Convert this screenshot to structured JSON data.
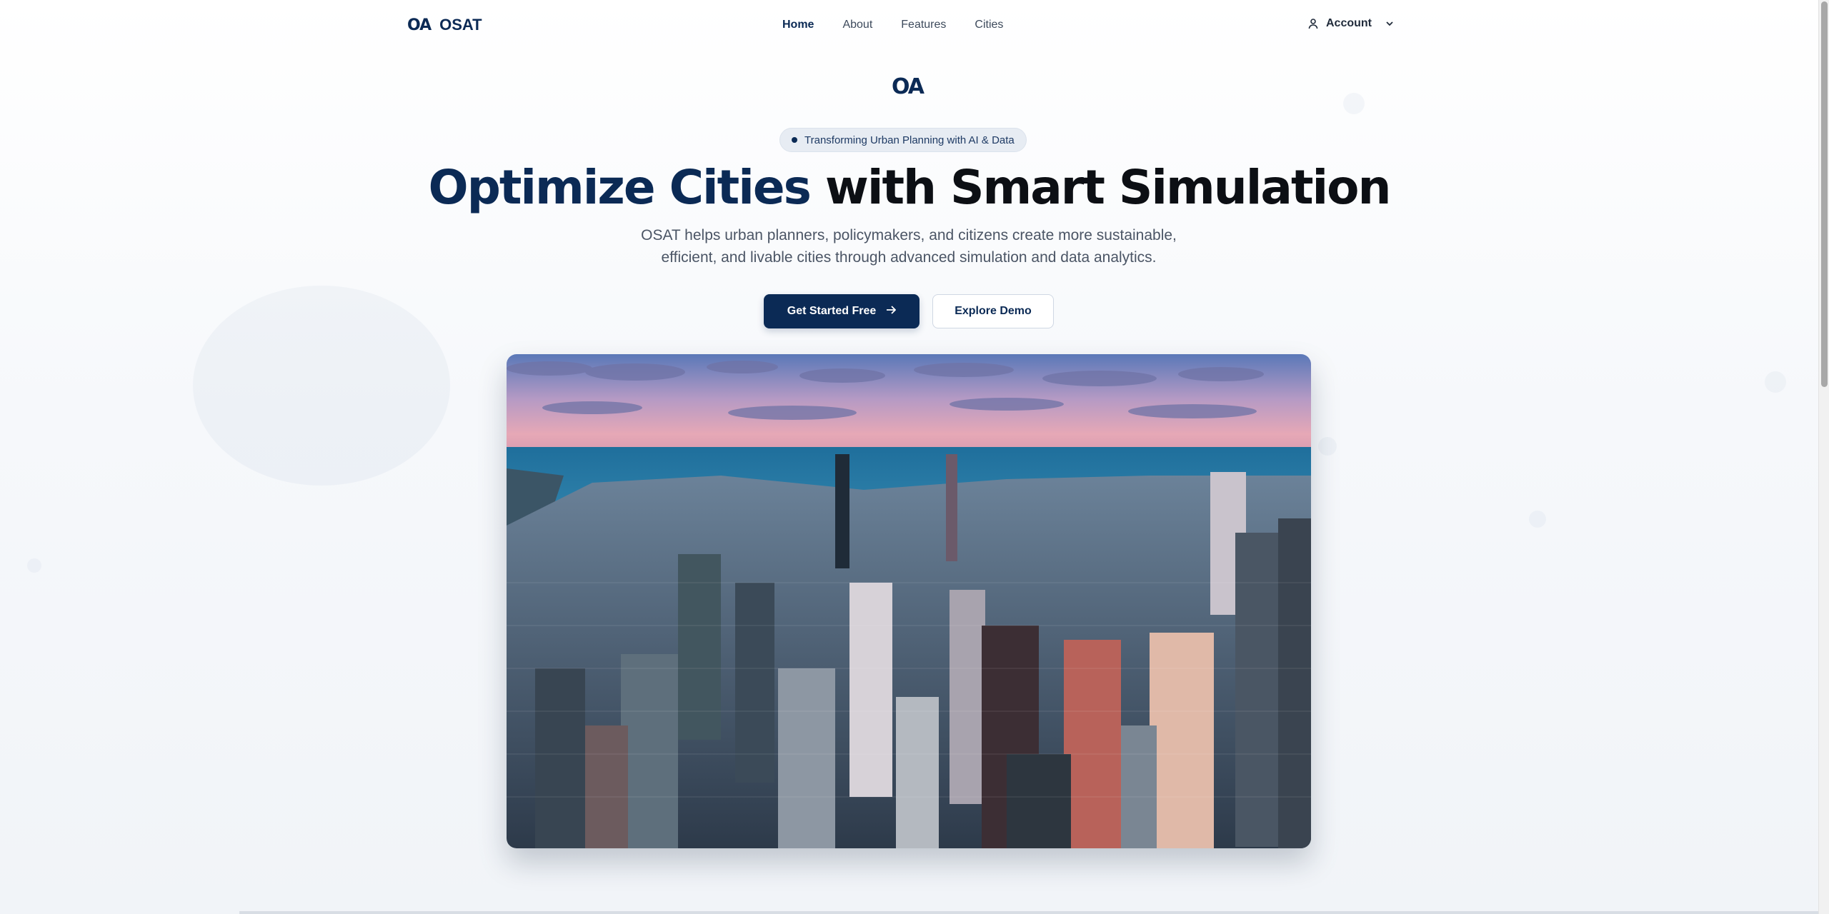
{
  "brand": {
    "mark": "OA",
    "name": "OSAT"
  },
  "nav": {
    "links": [
      {
        "label": "Home",
        "active": true
      },
      {
        "label": "About",
        "active": false
      },
      {
        "label": "Features",
        "active": false
      },
      {
        "label": "Cities",
        "active": false
      }
    ],
    "account_label": "Account"
  },
  "hero": {
    "logo_mark": "OA",
    "badge": "Transforming Urban Planning with AI & Data",
    "headline_accent": "Optimize Cities",
    "headline_rest": " with Smart Simulation",
    "subtitle": "OSAT helps urban planners, policymakers, and citizens create more sustainable, efficient, and livable cities through advanced simulation and data analytics.",
    "primary_button": "Get Started Free",
    "secondary_button": "Explore Demo"
  },
  "colors": {
    "brand_navy": "#0b2a55",
    "headline_dark": "#0c0f14",
    "badge_bg": "#e7ecf3"
  },
  "icons": {
    "account": "user-icon",
    "dropdown": "chevron-down-icon",
    "arrow": "arrow-right-icon"
  }
}
